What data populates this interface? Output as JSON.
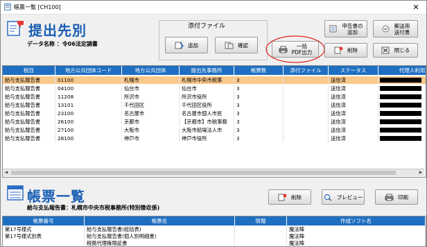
{
  "window": {
    "title": "帳票一覧 [CH100]",
    "close_glyph": "✕"
  },
  "top": {
    "heading": "提出先別",
    "data_name_label": "データ名称 ：令06法定調書",
    "attach_group_label": "添付ファイル",
    "buttons": {
      "add": "追加",
      "confirm": "確認",
      "bulk_pdf": "一括\nPDF出力",
      "declaration_add": "申告書の\n追加",
      "delete": "削除",
      "mail_form": "郵送用\n送付書",
      "close": "閉じる"
    }
  },
  "top_table": {
    "columns": [
      "税目",
      "地方公共団体コード",
      "地方公共団体",
      "提出先事務所",
      "帳票数",
      "添付ファイル",
      "ステータス",
      "代理人利用"
    ],
    "rows": [
      [
        "給与支払報告書",
        "01100",
        "札幌市",
        "札幌市中央市税事",
        "3",
        "",
        "送信済"
      ],
      [
        "給与支払報告書",
        "04100",
        "仙台市",
        "仙台市",
        "3",
        "",
        "送信済"
      ],
      [
        "給与支払報告書",
        "11208",
        "所沢市",
        "所沢市役所",
        "3",
        "",
        "送信済"
      ],
      [
        "給与支払報告書",
        "13101",
        "千代田区",
        "千代田区役所",
        "3",
        "",
        "送信済"
      ],
      [
        "給与支払報告書",
        "23100",
        "名古屋市",
        "名古屋市個人市民",
        "3",
        "",
        "送信済"
      ],
      [
        "給与支払報告書",
        "26100",
        "京都市",
        "【京都市】市税事務",
        "3",
        "",
        "送信済"
      ],
      [
        "給与支払報告書",
        "27100",
        "大阪市",
        "大阪市船場法人市",
        "3",
        "",
        "送信済"
      ],
      [
        "給与支払報告書",
        "28100",
        "神戸市",
        "神戸市役所",
        "3",
        "",
        "送信済"
      ]
    ],
    "selected_row": 0
  },
  "bottom": {
    "heading": "帳票一覧",
    "subtitle_prefix": "給与支払報告書",
    "subtitle_rest": "：札幌市中央市税事務所(特別徴収係)",
    "buttons": {
      "delete": "削除",
      "preview": "プレビュー",
      "print": "印刷"
    }
  },
  "bottom_table": {
    "columns": [
      "帳票番号",
      "帳票名",
      "情報",
      "作成ソフト名"
    ],
    "rows": [
      [
        "第17号様式",
        "給与支払報告書(総括表)",
        "",
        "魔法陣"
      ],
      [
        "第17号様式別表",
        "給与支払報告書(個人別明細書)",
        "",
        "魔法陣"
      ],
      [
        "",
        "税務代理権限証書",
        "",
        "魔法陣"
      ]
    ]
  },
  "colors": {
    "header_blue": "#1e6fc2",
    "heading_blue": "#1a5fb4",
    "selected_row": "#f8c98c",
    "highlight_circle": "#e02020"
  }
}
